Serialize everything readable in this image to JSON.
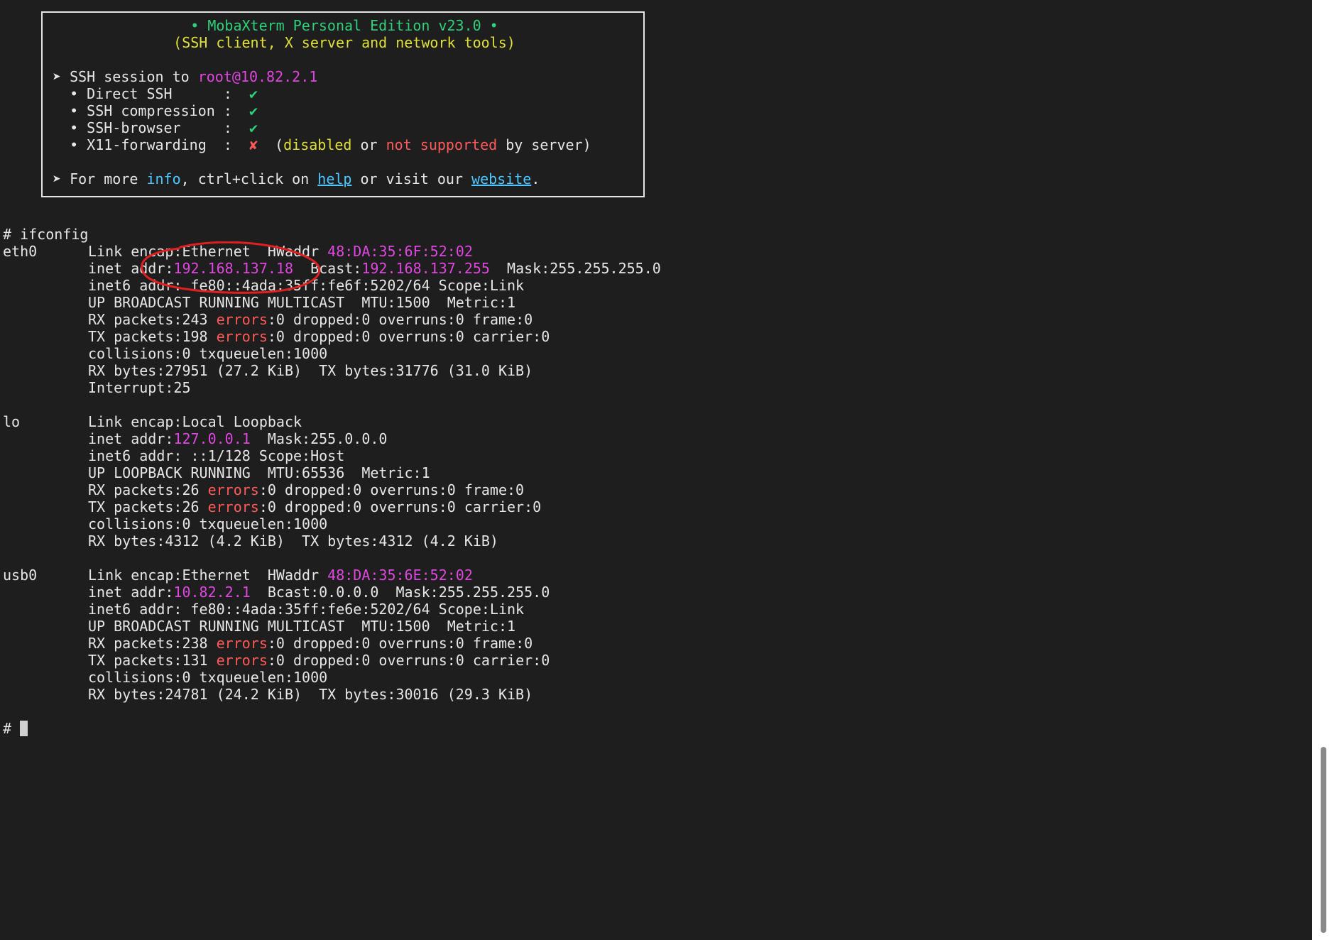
{
  "banner": {
    "title": "• MobaXterm Personal Edition v23.0 •",
    "subtitle": "(SSH client, X server and network tools)",
    "session_prefix": "➤ SSH session to ",
    "session_host": "root@10.82.2.1",
    "items": [
      {
        "label": "  • Direct SSH      :  ",
        "mark": "✔"
      },
      {
        "label": "  • SSH compression :  ",
        "mark": "✔"
      },
      {
        "label": "  • SSH-browser     :  ",
        "mark": "✔"
      }
    ],
    "x11": {
      "label": "  • X11-forwarding  :  ",
      "mark": "✘",
      "open": "  (",
      "disabled": "disabled",
      "or": " or ",
      "not_supported": "not supported",
      "tail": " by server)"
    },
    "info": {
      "prefix": "➤ For more ",
      "info": "info",
      "mid": ", ctrl+click on ",
      "help": "help",
      "mid2": " or visit our ",
      "website": "website",
      "end": "."
    }
  },
  "prompt_cmd": "# ifconfig",
  "eth0": {
    "name": "eth0",
    "l1a": "Link encap:Ethernet  HWaddr ",
    "hwaddr": "48:DA:35:6F:52:02",
    "l2a": "inet addr:",
    "inet": "192.168.137.18",
    "l2b": "  Bcast:",
    "bcast": "192.168.137.255",
    "l2c": "  Mask:255.255.255.0",
    "l3": "inet6 addr: fe80::4ada:35ff:fe6f:5202/64 Scope:Link",
    "l4": "UP BROADCAST RUNNING MULTICAST  MTU:1500  Metric:1",
    "rx_a": "RX packets:243 ",
    "rx_b": ":0 dropped:0 overruns:0 frame:0",
    "tx_a": "TX packets:198 ",
    "tx_b": ":0 dropped:0 overruns:0 carrier:0",
    "l7": "collisions:0 txqueuelen:1000",
    "l8": "RX bytes:27951 (27.2 KiB)  TX bytes:31776 (31.0 KiB)",
    "l9": "Interrupt:25"
  },
  "lo": {
    "name": "lo",
    "l1": "Link encap:Local Loopback",
    "l2a": "inet addr:",
    "inet": "127.0.0.1",
    "l2b": "  Mask:255.0.0.0",
    "l3": "inet6 addr: ::1/128 Scope:Host",
    "l4": "UP LOOPBACK RUNNING  MTU:65536  Metric:1",
    "rx_a": "RX packets:26 ",
    "rx_b": ":0 dropped:0 overruns:0 frame:0",
    "tx_a": "TX packets:26 ",
    "tx_b": ":0 dropped:0 overruns:0 carrier:0",
    "l7": "collisions:0 txqueuelen:1000",
    "l8": "RX bytes:4312 (4.2 KiB)  TX bytes:4312 (4.2 KiB)"
  },
  "usb0": {
    "name": "usb0",
    "l1a": "Link encap:Ethernet  HWaddr ",
    "hwaddr": "48:DA:35:6E:52:02",
    "l2a": "inet addr:",
    "inet": "10.82.2.1",
    "l2b": "  Bcast:0.0.0.0  Mask:255.255.255.0",
    "l3": "inet6 addr: fe80::4ada:35ff:fe6e:5202/64 Scope:Link",
    "l4": "UP BROADCAST RUNNING MULTICAST  MTU:1500  Metric:1",
    "rx_a": "RX packets:238 ",
    "rx_b": ":0 dropped:0 overruns:0 frame:0",
    "tx_a": "TX packets:131 ",
    "tx_b": ":0 dropped:0 overruns:0 carrier:0",
    "l7": "collisions:0 txqueuelen:1000",
    "l8": "RX bytes:24781 (24.2 KiB)  TX bytes:30016 (29.3 KiB)"
  },
  "errors_word": "errors",
  "final_prompt": "# ",
  "colors": {
    "background": "#1e1e1e",
    "text": "#e6e6e6",
    "green": "#2fd07b",
    "yellow": "#e0e03a",
    "magenta": "#e046e0",
    "red": "#ff5a5a",
    "cyan": "#4cc6ff",
    "annotation": "#e02020"
  }
}
